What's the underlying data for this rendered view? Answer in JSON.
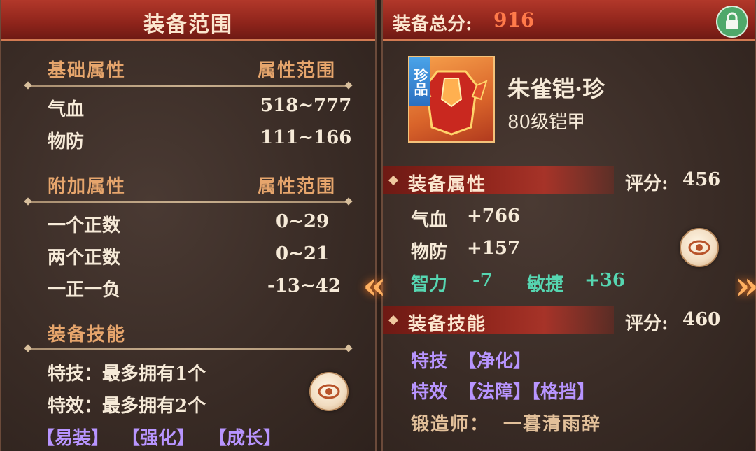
{
  "left_panel": {
    "title": "装备范围",
    "basic": {
      "header": "基础属性",
      "range_header": "属性范围",
      "rows": [
        {
          "name": "气血",
          "range": "518~777"
        },
        {
          "name": "物防",
          "range": "111~166"
        }
      ]
    },
    "extra": {
      "header": "附加属性",
      "range_header": "属性范围",
      "rows": [
        {
          "name": "一个正数",
          "range": "0~29"
        },
        {
          "name": "两个正数",
          "range": "0~21"
        },
        {
          "name": "一正一负",
          "range": "-13~42"
        }
      ]
    },
    "skills": {
      "header": "装备技能",
      "line1": "特技：最多拥有1个",
      "line2": "特效：最多拥有2个",
      "tags": [
        "【易装】",
        "【强化】",
        "【成长】"
      ]
    },
    "eye_icon": "eye-icon"
  },
  "right_panel": {
    "total_label": "装备总分:",
    "total_value": "916",
    "lock_icon": "lock-icon",
    "item": {
      "rarity_badge": "珍品",
      "name": "朱雀铠·珍",
      "subtitle": "80级铠甲"
    },
    "attrs": {
      "header": "装备属性",
      "score_label": "评分:",
      "score_value": "456",
      "rows": [
        {
          "name": "气血",
          "value": "+766"
        },
        {
          "name": "物防",
          "value": "+157"
        }
      ],
      "bonus": [
        {
          "name": "智力",
          "value": "-7"
        },
        {
          "name": "敏捷",
          "value": "+36"
        }
      ]
    },
    "skills": {
      "header": "装备技能",
      "score_label": "评分:",
      "score_value": "460",
      "stunt_label": "特技",
      "stunt_value": "【净化】",
      "effect_label": "特效",
      "effect_value": "【法障】【格挡】",
      "smith_label": "锻造师：",
      "smith_value": "一暮清雨辞"
    }
  },
  "colors": {
    "header_red": "#8e241b",
    "section_gold": "#e6a56c",
    "purple": "#b895ff",
    "teal": "#56d6b1",
    "score_red": "#ff7a4a"
  }
}
